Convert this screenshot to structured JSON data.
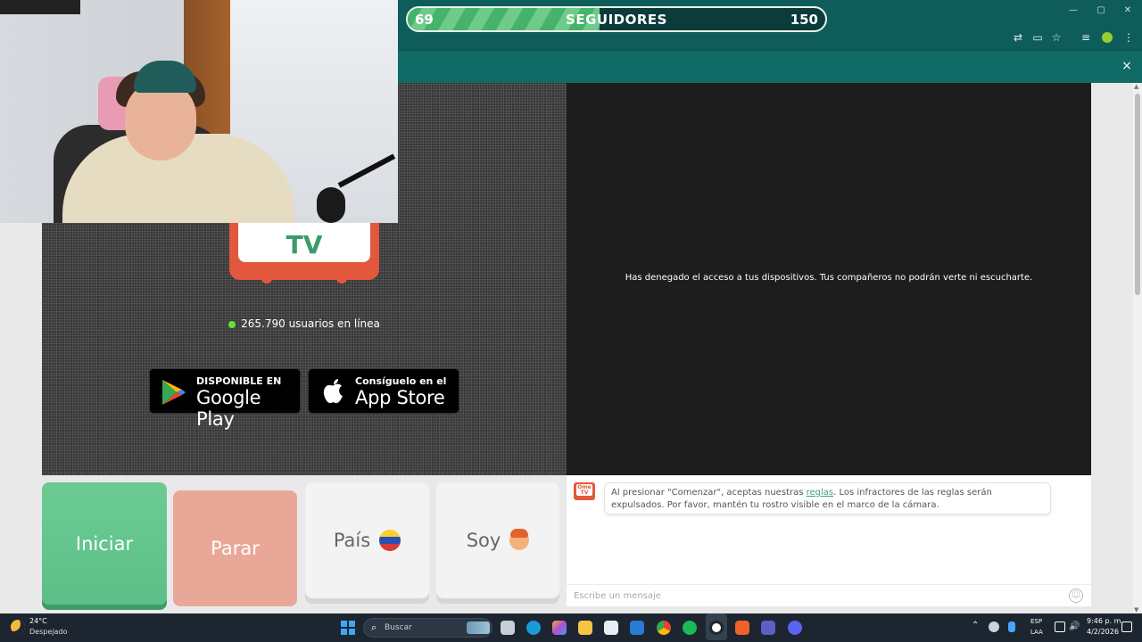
{
  "followers": {
    "current": "69",
    "label": "SEGUIDORES",
    "goal": "150",
    "progress_fraction": 0.46
  },
  "banner": {
    "close": "×"
  },
  "video": {
    "denied_message": "Has denegado el acceso a tus dispositivos. Tus compañeros no podrán verte ni escucharte.",
    "logo_text": "TV",
    "online_text": "265.790 usuarios en línea",
    "google_play": {
      "small": "DISPONIBLE EN",
      "big": "Google Play"
    },
    "app_store": {
      "small": "Consíguelo en el",
      "big": "App Store"
    }
  },
  "controls": {
    "start": "Iniciar",
    "stop": "Parar",
    "country": "País",
    "gender": "Soy"
  },
  "chat": {
    "logo_small": "Ome TV",
    "message_prefix": "Al presionar \"Comenzar\", aceptas nuestras ",
    "rules_link": "reglas",
    "message_suffix": ". Los infractores de las reglas serán expulsados. Por favor, mantén tu rostro visible en el marco de la cámara.",
    "input_placeholder": "Escribe un mensaje"
  },
  "taskbar": {
    "weather_temp": "24°C",
    "weather_desc": "Despejado",
    "search_placeholder": "Buscar",
    "lang_top": "ESP",
    "lang_bottom": "LAA",
    "time": "9:46 p. m.",
    "date": "4/2/2026"
  },
  "colors": {
    "browser_teal": "#0f5d5a",
    "ome_orange": "#e3583c",
    "ome_green": "#3b9b6b",
    "start_green": "#6bcb93",
    "stop_salmon": "#e9a797"
  }
}
